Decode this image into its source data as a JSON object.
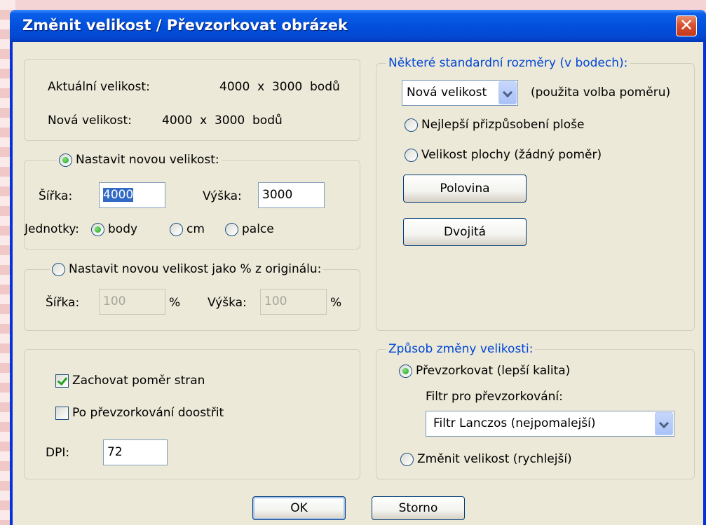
{
  "window": {
    "title": "Změnit velikost / Převzorkovat obrázek",
    "close_glyph": "✕"
  },
  "info": {
    "current_label": "Aktuální velikost:",
    "current_value": "4000  x  3000  bodů",
    "new_label": "Nová velikost:",
    "new_value": "4000  x  3000  bodů"
  },
  "set_size": {
    "radio_label": "Nastavit novou velikost:",
    "selected": true,
    "width_label": "Šířka:",
    "width_value": "4000",
    "height_label": "Výška:",
    "height_value": "3000",
    "units_label": "Jednotky:",
    "units": [
      {
        "label": "body",
        "selected": true
      },
      {
        "label": "cm",
        "selected": false
      },
      {
        "label": "palce",
        "selected": false
      }
    ]
  },
  "set_percent": {
    "radio_label": "Nastavit novou velikost jako % z originálu:",
    "selected": false,
    "width_label": "Šířka:",
    "width_value": "100",
    "height_label": "Výška:",
    "height_value": "100",
    "percent_sign": "%"
  },
  "options": {
    "keep_ratio": {
      "label": "Zachovat poměr stran",
      "checked": true
    },
    "sharpen": {
      "label": "Po převzorkování doostřit",
      "checked": false
    },
    "dpi_label": "DPI:",
    "dpi_value": "72"
  },
  "standard": {
    "legend": "Některé standardní rozměry (v bodech):",
    "combo_value": "Nová velikost",
    "combo_note": "(použita volba poměru)",
    "best_fit": "Nejlepší přizpůsobení ploše",
    "screen_size": "Velikost plochy (žádný poměr)",
    "half_button": "Polovina",
    "double_button": "Dvojitá"
  },
  "method": {
    "legend": "Způsob změny velikosti:",
    "resample_label": "Převzorkovat (lepší kalita)",
    "resample_selected": true,
    "filter_label": "Filtr pro převzorkování:",
    "filter_value": "Filtr Lanczos (nejpomalejší)",
    "resize_label": "Změnit velikost (rychlejší)",
    "resize_selected": false
  },
  "buttons": {
    "ok": "OK",
    "cancel": "Storno"
  },
  "colors": {
    "title_bar": "#0250dc",
    "group_legend": "#0046d5",
    "dialog_bg": "#ece9d8",
    "close_button": "#d8512f"
  }
}
